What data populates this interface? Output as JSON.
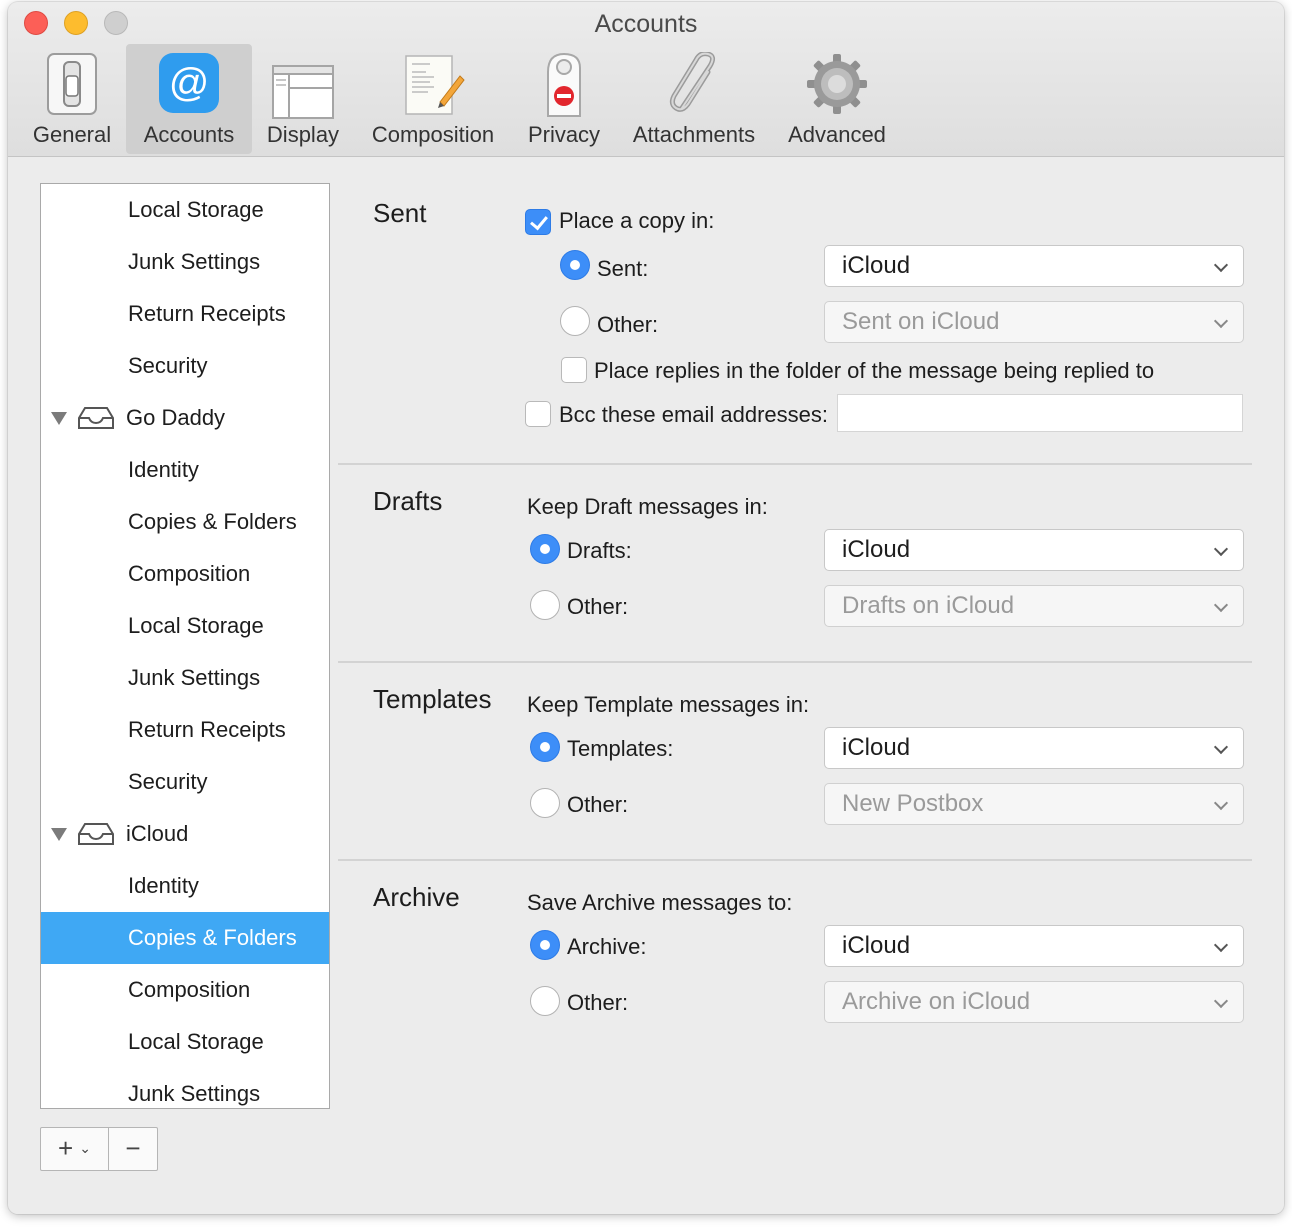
{
  "window": {
    "title": "Accounts"
  },
  "toolbar": [
    {
      "label": "General",
      "icon": "toggle-switch-icon"
    },
    {
      "label": "Accounts",
      "icon": "at-sign-icon",
      "selected": true
    },
    {
      "label": "Display",
      "icon": "window-layout-icon"
    },
    {
      "label": "Composition",
      "icon": "letter-pencil-icon"
    },
    {
      "label": "Privacy",
      "icon": "door-hanger-icon"
    },
    {
      "label": "Attachments",
      "icon": "paperclip-icon"
    },
    {
      "label": "Advanced",
      "icon": "gear-icon"
    }
  ],
  "sidebar": {
    "items": [
      {
        "label": "Local Storage"
      },
      {
        "label": "Junk Settings"
      },
      {
        "label": "Return Receipts"
      },
      {
        "label": "Security"
      },
      {
        "label": "Go Daddy",
        "account": true
      },
      {
        "label": "Identity"
      },
      {
        "label": "Copies & Folders"
      },
      {
        "label": "Composition"
      },
      {
        "label": "Local Storage"
      },
      {
        "label": "Junk Settings"
      },
      {
        "label": "Return Receipts"
      },
      {
        "label": "Security"
      },
      {
        "label": "iCloud",
        "account": true
      },
      {
        "label": "Identity"
      },
      {
        "label": "Copies & Folders",
        "selected": true
      },
      {
        "label": "Composition"
      },
      {
        "label": "Local Storage"
      },
      {
        "label": "Junk Settings"
      }
    ],
    "add_label": "+",
    "remove_label": "−"
  },
  "sent": {
    "title": "Sent",
    "place_copy_label": "Place a copy in:",
    "place_copy_checked": true,
    "sent_option_label": "Sent:",
    "sent_value": "iCloud",
    "other_label": "Other:",
    "other_value": "Sent on iCloud",
    "replies_label": "Place replies in the folder of the message being replied to",
    "bcc_label": "Bcc these email addresses:",
    "bcc_value": ""
  },
  "drafts": {
    "title": "Drafts",
    "keep_label": "Keep Draft messages in:",
    "option_label": "Drafts:",
    "option_value": "iCloud",
    "other_label": "Other:",
    "other_value": "Drafts on iCloud"
  },
  "templates": {
    "title": "Templates",
    "keep_label": "Keep Template messages in:",
    "option_label": "Templates:",
    "option_value": "iCloud",
    "other_label": "Other:",
    "other_value": "New Postbox"
  },
  "archive": {
    "title": "Archive",
    "keep_label": "Save Archive messages to:",
    "option_label": "Archive:",
    "option_value": "iCloud",
    "other_label": "Other:",
    "other_value": "Archive on iCloud"
  },
  "colors": {
    "accent": "#3d8ef8",
    "selection": "#3fa8f4"
  }
}
